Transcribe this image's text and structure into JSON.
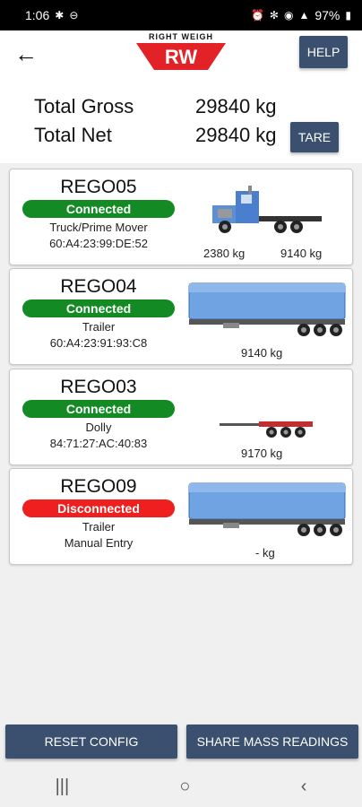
{
  "status_bar": {
    "time": "1:06",
    "battery": "97%"
  },
  "app_bar": {
    "logo_text": "RIGHT WEIGH",
    "logo_letters": "RW",
    "help_label": "HELP",
    "brand_color": "#e32227"
  },
  "totals": {
    "gross_label": "Total Gross",
    "gross_value": "29840 kg",
    "net_label": "Total Net",
    "net_value": "29840 kg",
    "tare_label": "TARE"
  },
  "units": [
    {
      "name": "REGO05",
      "status": "Connected",
      "type": "Truck/Prime Mover",
      "detail": "60:A4:23:99:DE:52",
      "weight_1": "2380 kg",
      "weight_2": "9140 kg",
      "icon": "truck-prime-mover-icon"
    },
    {
      "name": "REGO04",
      "status": "Connected",
      "type": "Trailer",
      "detail": "60:A4:23:91:93:C8",
      "weight_1": "9140 kg",
      "icon": "trailer-icon"
    },
    {
      "name": "REGO03",
      "status": "Connected",
      "type": "Dolly",
      "detail": "84:71:27:AC:40:83",
      "weight_1": "9170 kg",
      "icon": "dolly-icon"
    },
    {
      "name": "REGO09",
      "status": "Disconnected",
      "type": "Trailer",
      "detail": "Manual Entry",
      "weight_1": "- kg",
      "icon": "trailer-icon"
    }
  ],
  "colors": {
    "connected": "#138a24",
    "disconnected": "#f01f1f",
    "button": "#3b4f6e"
  },
  "buttons": {
    "reset": "RESET CONFIG",
    "share": "SHARE MASS READINGS"
  }
}
